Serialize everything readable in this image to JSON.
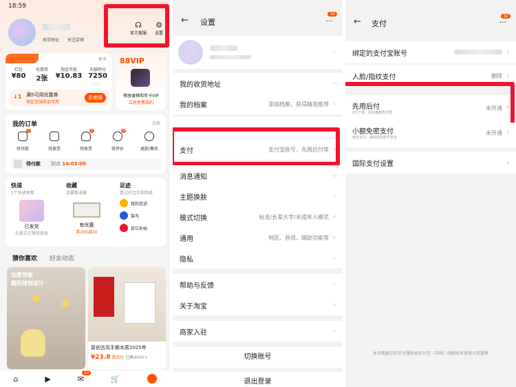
{
  "panel1": {
    "status_time": "18:59",
    "header": {
      "address_label": "收货地址",
      "follow_label": "关注店铺",
      "service_label": "官方客服",
      "settings_label": "设置"
    },
    "assets": {
      "more_label": "更多",
      "items": [
        {
          "label": "红包",
          "value": "¥80"
        },
        {
          "label": "优惠券",
          "value": "2张"
        },
        {
          "label": "淘金币抵",
          "value": "¥10.83"
        },
        {
          "label": "天猫积分",
          "value": "7250"
        }
      ],
      "coupon_title": "满5可用优惠券",
      "coupon_sub": "指定范围商品可用",
      "coupon_button": "去使用"
    },
    "vip": {
      "title": "88VIP",
      "line1": "畅享香槟和年卡VIP",
      "line2": "立抢免费福利"
    },
    "orders": {
      "title": "我的订单",
      "all_label": "全部",
      "items": [
        {
          "label": "待付款",
          "badge": "2"
        },
        {
          "label": "待发货",
          "badge": ""
        },
        {
          "label": "待收货",
          "badge": "3"
        },
        {
          "label": "待评价",
          "badge": "3"
        },
        {
          "label": "退款/售后",
          "badge": ""
        }
      ],
      "pending_label": "待付款",
      "pending_timer_prefix": "剩余",
      "pending_timer": "14:03:00"
    },
    "express": {
      "title": "快递",
      "sub": "2个快递更新",
      "status": "已发货",
      "desc": "包裹正在等待揽收"
    },
    "favorites": {
      "title": "收藏",
      "sub": "会赛看收藏",
      "status": "有优惠",
      "desc": "券300减30"
    },
    "footprint": {
      "title": "足迹",
      "sub": "看过的宝贝和频道",
      "items": [
        "我的足迹",
        "菜鸟",
        "百亿补贴"
      ]
    },
    "feed": {
      "tabs": [
        "猜你喜欢",
        "好友动态"
      ],
      "card1_title": "加厚背板",
      "card1_sub": "圆形挂钩设计",
      "card2_title": "原创古风手撕木质2025年",
      "card2_price": "¥23.8",
      "card2_tag": "券后价",
      "card2_sales": "已售4000+"
    },
    "tabbar_badge": "32"
  },
  "panel2": {
    "title": "设置",
    "badge": "32",
    "rows": [
      {
        "label": "我的收货地址",
        "value": ""
      },
      {
        "label": "我的档案",
        "value": "添加档案，获得精准推荐"
      },
      {
        "label": "支付",
        "value": "支付宝账号，先用后付等"
      },
      {
        "label": "消息通知",
        "value": ""
      },
      {
        "label": "主题换肤",
        "value": ""
      },
      {
        "label": "模式切换",
        "value": "标准/长辈大字/未成年人模式"
      },
      {
        "label": "通用",
        "value": "地区、音效、辅助功能等"
      },
      {
        "label": "隐私",
        "value": ""
      },
      {
        "label": "帮助与反馈",
        "value": ""
      },
      {
        "label": "关于淘宝",
        "value": ""
      },
      {
        "label": "商家入驻",
        "value": ""
      }
    ],
    "switch_account": "切换账号",
    "logout": "退出登录"
  },
  "panel3": {
    "title": "支付",
    "badge": "32",
    "rows": [
      {
        "label": "绑定的支付宝账号",
        "sub": "",
        "value": ""
      },
      {
        "label": "人脸/指纹支付",
        "sub": "",
        "value": "删除"
      },
      {
        "label": "先用后付",
        "sub": "0元下单，收货满意再付款",
        "value": "未开通"
      },
      {
        "label": "小额免密支付",
        "sub": "免密支付，保护您的账号安全",
        "value": "未开通"
      },
      {
        "label": "国际支付设置",
        "sub": "",
        "value": ""
      }
    ],
    "footer": "本页面展示的支付服务由支付宝（中国）网络技术有限公司提供"
  },
  "colors": {
    "accent": "#ff5000",
    "highlight": "#f0142f"
  }
}
